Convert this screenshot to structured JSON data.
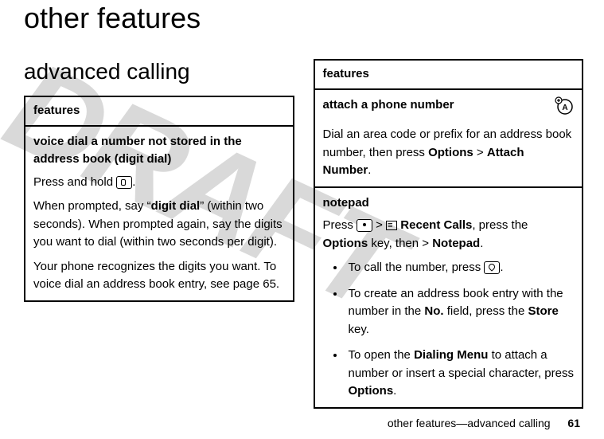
{
  "watermark": "DRAFT",
  "page_title": "other features",
  "section_title": "advanced calling",
  "left_table": {
    "header": "features",
    "cell1": {
      "title": "voice dial a number not stored in the address book (digit dial)",
      "p1a": "Press and hold ",
      "p1b": ".",
      "p2a": "When prompted, say “",
      "p2_bold": "digit dial",
      "p2b": "” (within two seconds). When prompted again, say the digits you want to dial (within two  seconds per digit).",
      "p3": "Your phone recognizes the digits you want. To voice dial an address book entry, see page 65."
    }
  },
  "right_table": {
    "header": "features",
    "cell1": {
      "title": "attach a phone number",
      "p1a": "Dial an area code or prefix for an address book number, then press ",
      "options": "Options",
      "gt": " > ",
      "attach": "Attach Number",
      "p1b": "."
    },
    "cell2": {
      "title": "notepad",
      "p1a": "Press ",
      "gt": " > ",
      "recent": "Recent Calls",
      "p1b": ", press the ",
      "options": "Options",
      "p1c": " key, then > ",
      "notepad": "Notepad",
      "p1d": ".",
      "b1a": "To call the number, press ",
      "b1b": ".",
      "b2a": "To create an address book entry with the number in the ",
      "no": "No.",
      "b2b": " field, press the ",
      "store": "Store",
      "b2c": " key.",
      "b3a": "To open the ",
      "dm": "Dialing Menu",
      "b3b": " to attach a number or insert a special character, press ",
      "options2": "Options",
      "b3c": "."
    }
  },
  "footer": {
    "text": "other features—advanced calling",
    "page": "61"
  }
}
